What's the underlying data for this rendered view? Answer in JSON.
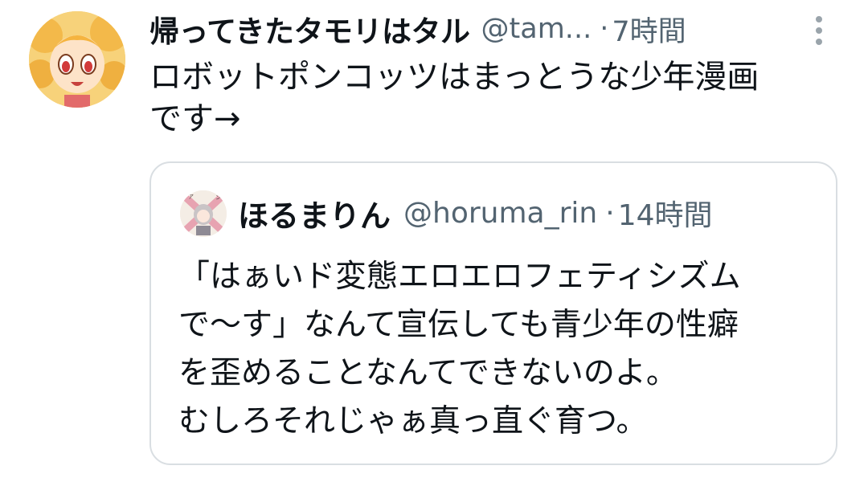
{
  "tweet": {
    "author": {
      "display_name": "帰ってきたタモリはタル",
      "handle": "@tam...",
      "avatar_icon": "anime-girl-avatar"
    },
    "separator": "·",
    "time": "7時間",
    "more_icon": "more-vertical-icon",
    "text": "ロボットポンコッツはまっとうな少年漫画\nです→"
  },
  "quoted_tweet": {
    "author": {
      "display_name": "ほるまりん",
      "handle": "@horuma_rin",
      "avatar_icon": "anime-character-avatar"
    },
    "separator": "·",
    "time": "14時間",
    "text": "「はぁいド変態エロエロフェティシズム\nで〜す」なんて宣伝しても青少年の性癖\nを歪めることなんてできないのよ。\nむしろそれじゃぁ真っ直ぐ育つ。"
  },
  "colors": {
    "text_primary": "#0f1419",
    "text_secondary": "#536471",
    "border": "#d9dee2",
    "background": "#ffffff"
  }
}
